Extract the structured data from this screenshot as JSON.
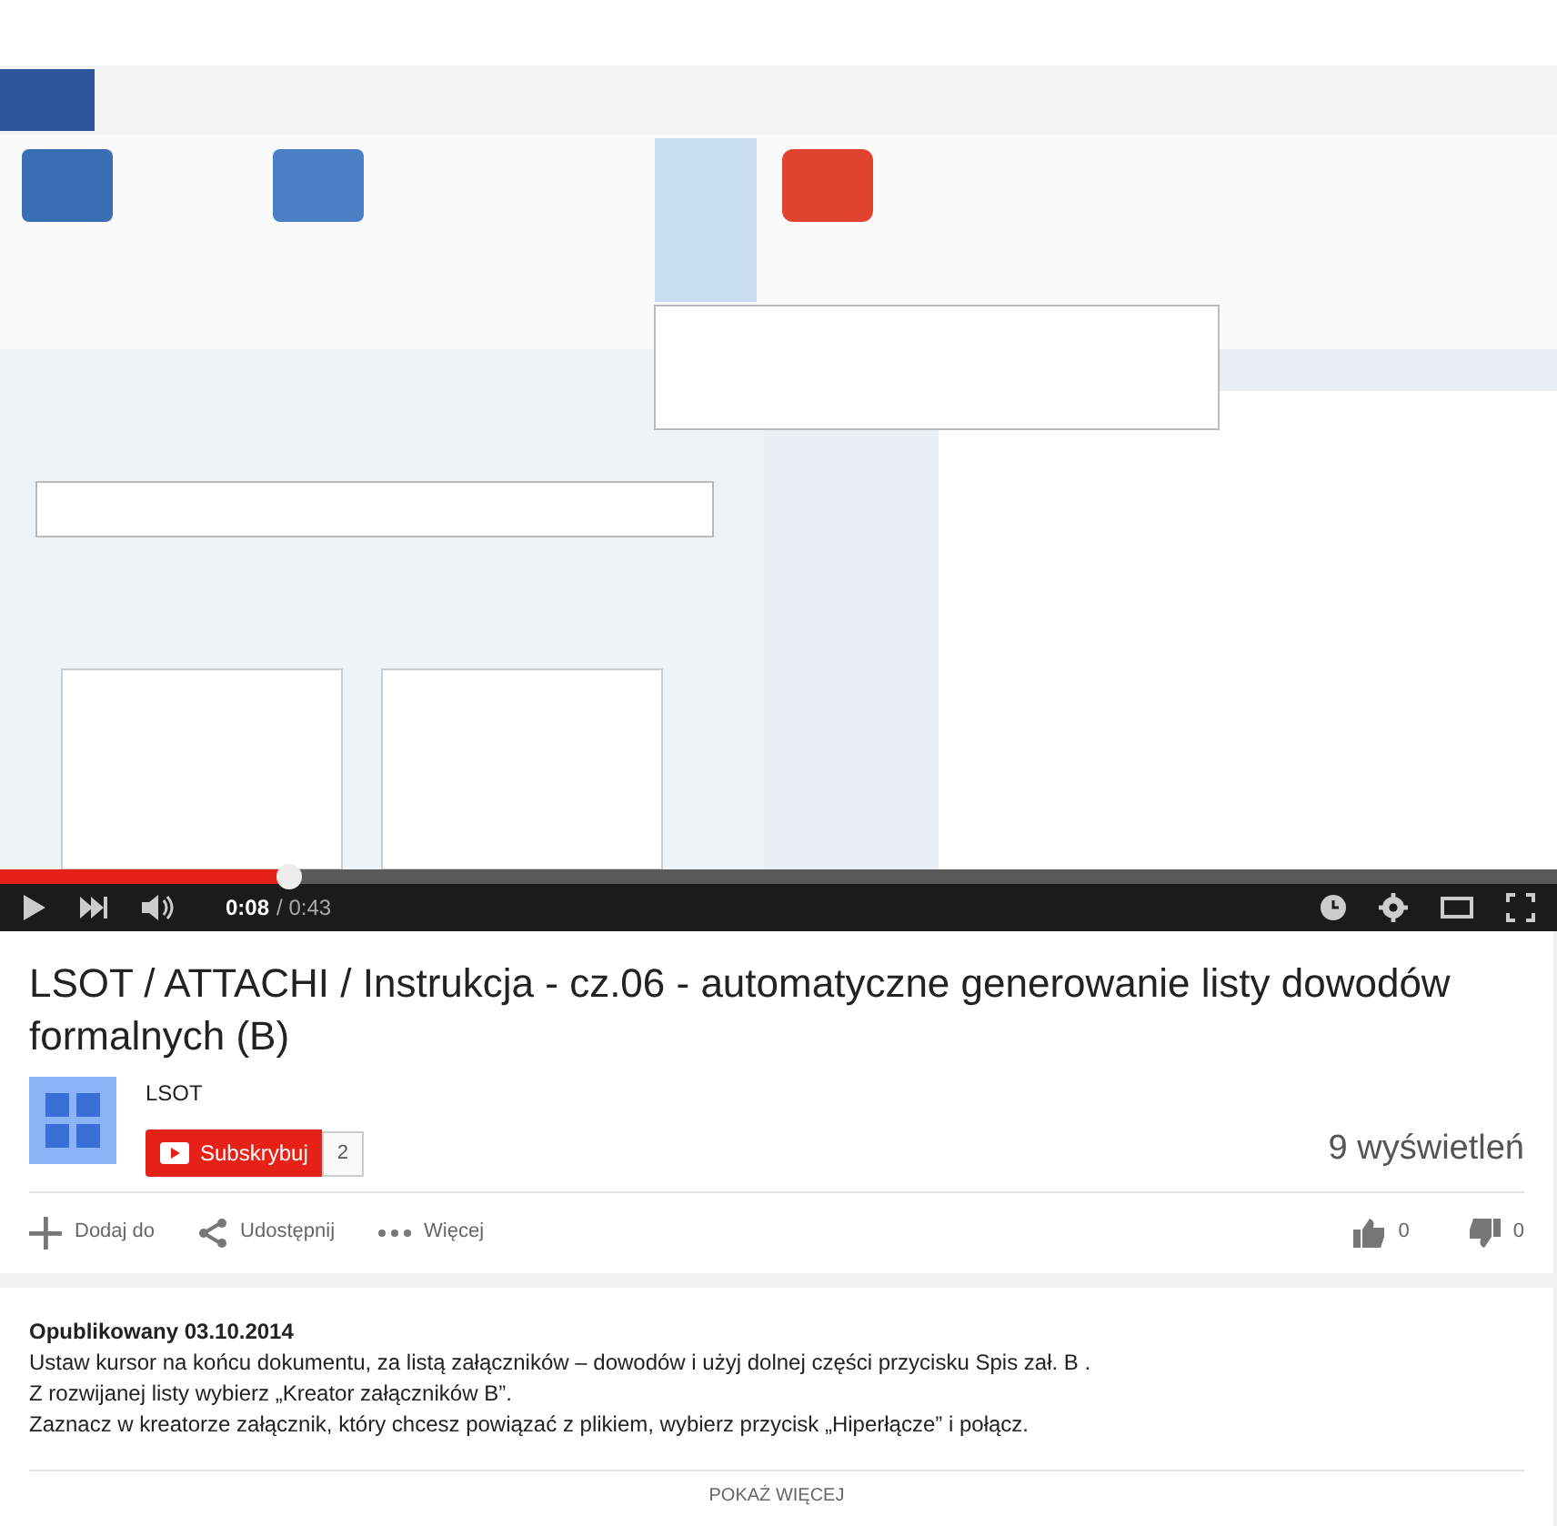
{
  "player": {
    "level": 0.186,
    "time_current": "0:08",
    "time_total": "/ 0:43"
  },
  "title": "LSOT / ATTACHI / Instrukcja - cz.06 - automatyczne generowanie listy dowodów formalnych (B)",
  "channel": {
    "name": "LSOT",
    "subscribe_label": "Subskrybuj",
    "subscriber_count": "2"
  },
  "views": "9 wyświetleń",
  "actions": [
    {
      "kind": "add",
      "label": "Dodaj do"
    },
    {
      "kind": "share",
      "label": "Udostępnij"
    },
    {
      "kind": "more",
      "label": "Więcej"
    }
  ],
  "likes": "0",
  "dislikes": "0",
  "description": {
    "published": "Opublikowany 03.10.2014",
    "lines": [
      "Ustaw kursor na końcu dokumentu, za listą załączników – dowodów i użyj dolnej części przycisku Spis zał. B .",
      "Z rozwijanej listy wybierz „Kreator załączników B”.",
      "Zaznacz w kreatorze załącznik, który chcesz powiązać z plikiem, wybierz przycisk „Hiperłącze” i połącz."
    ],
    "show_more": "POKAŻ WIĘCEJ"
  }
}
